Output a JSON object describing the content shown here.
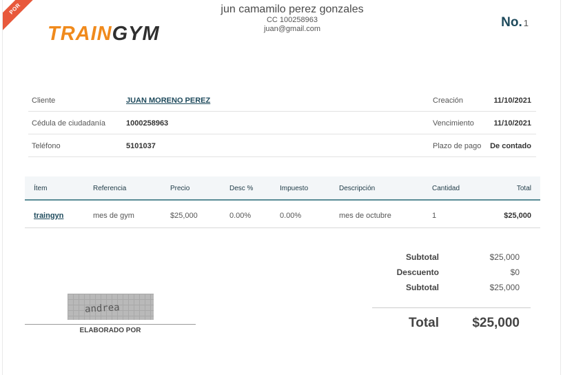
{
  "ribbon": {
    "label": "POR"
  },
  "logo": {
    "part1": "TRAIN",
    "part2": "GYM"
  },
  "company": {
    "name": "jun camamilo perez gonzales",
    "id_line": "CC 100258963",
    "email": "juan@gmail.com"
  },
  "invoice": {
    "no_label": "No.",
    "number": "1"
  },
  "info": {
    "client_label": "Cliente",
    "client_value": "JUAN MORENO PEREZ",
    "id_label": "Cédula de ciudadanía",
    "id_value": "1000258963",
    "phone_label": "Teléfono",
    "phone_value": "5101037",
    "created_label": "Creación",
    "created_value": "11/10/2021",
    "due_label": "Vencimiento",
    "due_value": "11/10/2021",
    "term_label": "Plazo de pago",
    "term_value": "De contado"
  },
  "items": {
    "headers": [
      "Ítem",
      "Referencia",
      "Precio",
      "Desc %",
      "Impuesto",
      "Descripción",
      "Cantidad",
      "Total"
    ],
    "rows": [
      [
        "traingyn",
        "mes de gym",
        "$25,000",
        "0.00%",
        "0.00%",
        "mes de octubre",
        "1",
        "$25,000"
      ]
    ]
  },
  "totals": {
    "subtotal_label": "Subtotal",
    "subtotal_value": "$25,000",
    "discount_label": "Descuento",
    "discount_value": "$0",
    "subtotal2_label": "Subtotal",
    "subtotal2_value": "$25,000",
    "total_label": "Total",
    "total_value": "$25,000"
  },
  "signature": {
    "handwriting": "andrea",
    "label": "ELABORADO POR"
  }
}
